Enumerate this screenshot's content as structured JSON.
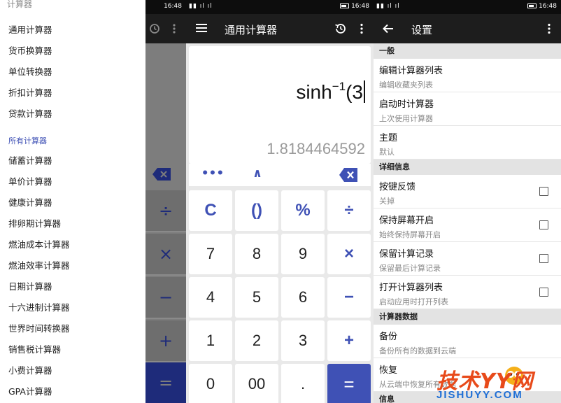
{
  "drawer": {
    "top_fragment": "计算器",
    "items": [
      {
        "label": "通用计算器"
      },
      {
        "label": "货币换算器"
      },
      {
        "label": "单位转换器"
      },
      {
        "label": "折扣计算器"
      },
      {
        "label": "贷款计算器"
      }
    ],
    "section_title": "所有计算器",
    "all_items": [
      {
        "label": "储蓄计算器"
      },
      {
        "label": "单价计算器"
      },
      {
        "label": "健康计算器"
      },
      {
        "label": "排卵期计算器"
      },
      {
        "label": "燃油成本计算器"
      },
      {
        "label": "燃油效率计算器"
      },
      {
        "label": "日期计算器"
      },
      {
        "label": "十六进制计算器"
      },
      {
        "label": "世界时间转换器"
      },
      {
        "label": "销售税计算器"
      },
      {
        "label": "小费计算器"
      },
      {
        "label": "GPA计算器"
      }
    ]
  },
  "status_bar": {
    "time": "16:48"
  },
  "dimmed_keys": [
    "÷",
    "×",
    "−",
    "+",
    "="
  ],
  "calculator": {
    "title": "通用计算器",
    "expression_prefix": "sinh",
    "expression_superscript": "−1",
    "expression_suffix": "(3",
    "result": "1.8184464592",
    "aux_keys": {
      "more": "•••",
      "inverse": "∧"
    },
    "keys": [
      {
        "label": "C",
        "kind": "op"
      },
      {
        "label": "()",
        "kind": "op"
      },
      {
        "label": "%",
        "kind": "op"
      },
      {
        "label": "÷",
        "kind": "op"
      },
      {
        "label": "7",
        "kind": "num"
      },
      {
        "label": "8",
        "kind": "num"
      },
      {
        "label": "9",
        "kind": "num"
      },
      {
        "label": "×",
        "kind": "op"
      },
      {
        "label": "4",
        "kind": "num"
      },
      {
        "label": "5",
        "kind": "num"
      },
      {
        "label": "6",
        "kind": "num"
      },
      {
        "label": "−",
        "kind": "op"
      },
      {
        "label": "1",
        "kind": "num"
      },
      {
        "label": "2",
        "kind": "num"
      },
      {
        "label": "3",
        "kind": "num"
      },
      {
        "label": "+",
        "kind": "op"
      },
      {
        "label": "0",
        "kind": "num"
      },
      {
        "label": "00",
        "kind": "num"
      },
      {
        "label": ".",
        "kind": "num"
      },
      {
        "label": "=",
        "kind": "eq"
      }
    ]
  },
  "settings": {
    "title": "设置",
    "sections": [
      {
        "header": "一般",
        "rows": [
          {
            "title": "编辑计算器列表",
            "subtitle": "编辑收藏夹列表",
            "checkbox": false
          },
          {
            "title": "启动时计算器",
            "subtitle": "上次使用计算器",
            "checkbox": false
          },
          {
            "title": "主题",
            "subtitle": "默认",
            "checkbox": false
          }
        ]
      },
      {
        "header": "详细信息",
        "rows": [
          {
            "title": "按键反馈",
            "subtitle": "关掉",
            "checkbox": true,
            "checked": false
          },
          {
            "title": "保持屏幕开启",
            "subtitle": "始终保持屏幕开启",
            "checkbox": true,
            "checked": false
          },
          {
            "title": "保留计算记录",
            "subtitle": "保留最后计算记录",
            "checkbox": true,
            "checked": false
          },
          {
            "title": "打开计算器列表",
            "subtitle": "启动应用时打开列表",
            "checkbox": true,
            "checked": false
          }
        ]
      },
      {
        "header": "计算器数据",
        "rows": [
          {
            "title": "备份",
            "subtitle": "备份所有的数据到云端",
            "checkbox": false
          },
          {
            "title": "恢复",
            "subtitle": "从云端中恢复所有数据",
            "checkbox": false
          }
        ]
      },
      {
        "header": "信息",
        "rows": []
      }
    ]
  },
  "watermark": {
    "main": "技术YY网",
    "sub": "JISHUYY.COM"
  },
  "colors": {
    "accent": "#3f51b5",
    "toolbar": "#1d1d1d",
    "status_bar": "#0d0d0d",
    "watermark_red": "#e84a1a",
    "watermark_blue": "#1f6fd6"
  }
}
